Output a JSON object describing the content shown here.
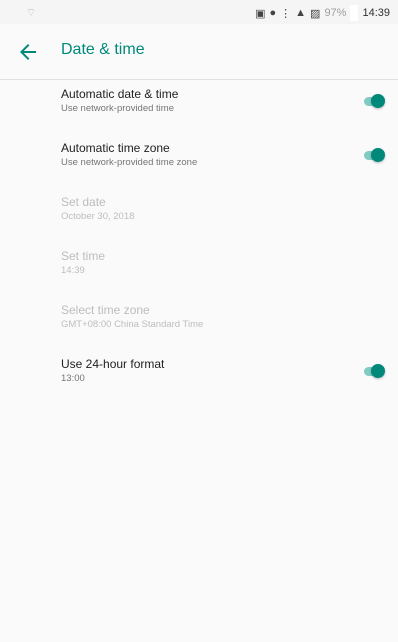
{
  "status_bar": {
    "battery_percent": "97%",
    "time": "14:39",
    "icons": [
      "wifi-off-icon",
      "cast-icon",
      "location-icon",
      "vibrate-icon",
      "signal-icon",
      "no-sim-icon",
      "battery-icon"
    ]
  },
  "app_bar": {
    "title": "Date & time",
    "back_icon": "back-arrow-icon",
    "accent_color": "#00897b"
  },
  "settings": [
    {
      "title": "Automatic date & time",
      "subtitle": "Use network-provided time",
      "enabled": true,
      "switch_on": true
    },
    {
      "title": "Automatic time zone",
      "subtitle": "Use network-provided time zone",
      "enabled": true,
      "switch_on": true
    },
    {
      "title": "Set date",
      "subtitle": "October 30, 2018",
      "enabled": false
    },
    {
      "title": "Set time",
      "subtitle": "14:39",
      "enabled": false
    },
    {
      "title": "Select time zone",
      "subtitle": "GMT+08:00 China Standard Time",
      "enabled": false
    },
    {
      "title": "Use 24-hour format",
      "subtitle": "13:00",
      "enabled": true,
      "switch_on": true
    }
  ]
}
